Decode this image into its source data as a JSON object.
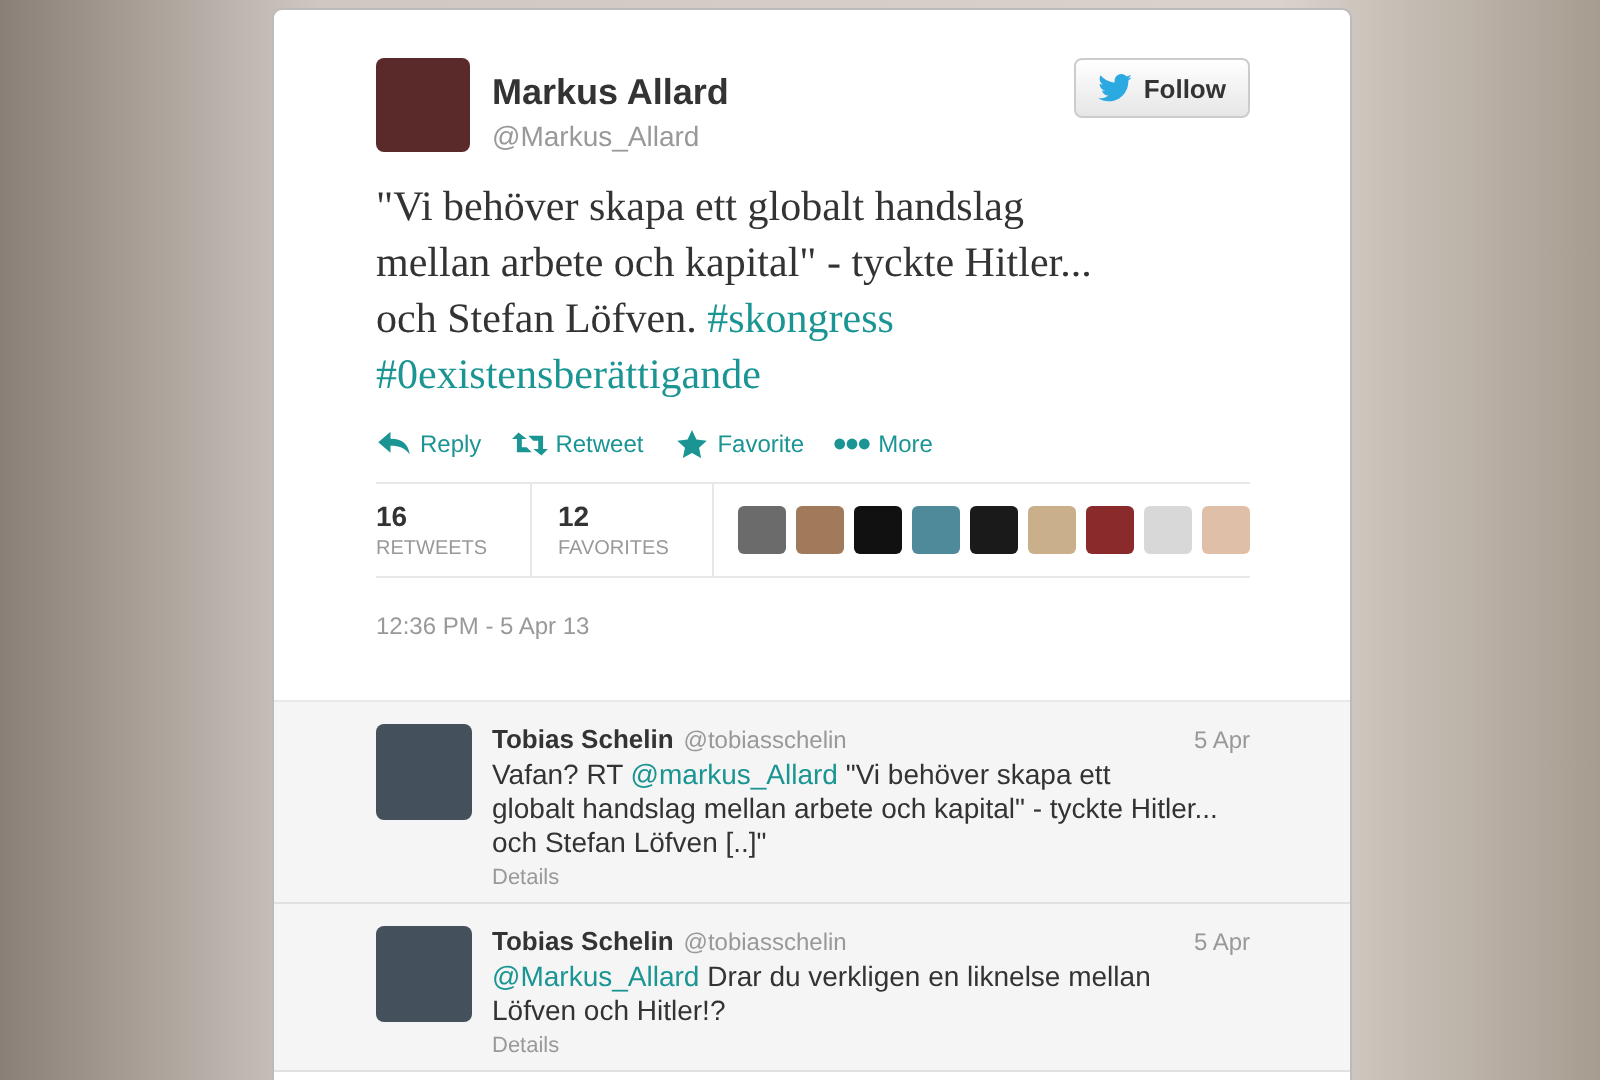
{
  "tweet": {
    "name": "Markus Allard",
    "handle": "@Markus_Allard",
    "follow_label": "Follow",
    "lines": [
      [
        {
          "kind": "text",
          "text": "\"Vi behöver skapa ett globalt handslag"
        }
      ],
      [
        {
          "kind": "text",
          "text": "mellan arbete och kapital\" - tyckte Hitler..."
        }
      ],
      [
        {
          "kind": "text",
          "text": "och Stefan Löfven. "
        },
        {
          "kind": "hashtag",
          "text": "#skongress"
        }
      ],
      [
        {
          "kind": "hashtag",
          "text": "#0existensberättigande"
        }
      ]
    ],
    "actions": [
      {
        "kind": "reply",
        "label": "Reply"
      },
      {
        "kind": "retweet",
        "label": "Retweet"
      },
      {
        "kind": "favorite",
        "label": "Favorite"
      },
      {
        "kind": "more",
        "label": "More"
      }
    ],
    "stats": [
      {
        "count": "16",
        "label": "RETWEETS"
      },
      {
        "count": "12",
        "label": "FAVORITES"
      }
    ],
    "timestamp": "12:36 PM - 5 Apr 13"
  },
  "replies": [
    {
      "name": "Tobias Schelin",
      "handle": "@tobiasschelin",
      "date": "5 Apr",
      "lines": [
        [
          {
            "kind": "text",
            "text": "Vafan? RT "
          },
          {
            "kind": "mention",
            "text": "@markus_Allard"
          },
          {
            "kind": "text",
            "text": " \"Vi behöver skapa ett"
          }
        ],
        [
          {
            "kind": "text",
            "text": "globalt handslag mellan arbete och kapital\" - tyckte Hitler..."
          }
        ],
        [
          {
            "kind": "text",
            "text": "och Stefan Löfven [..]\""
          }
        ]
      ],
      "details": "Details"
    },
    {
      "name": "Tobias Schelin",
      "handle": "@tobiasschelin",
      "date": "5 Apr",
      "lines": [
        [
          {
            "kind": "mention",
            "text": "@Markus_Allard"
          },
          {
            "kind": "text",
            "text": " Drar du verkligen en liknelse mellan"
          }
        ],
        [
          {
            "kind": "text",
            "text": "Löfven och Hitler!?"
          }
        ]
      ],
      "details": "Details"
    }
  ]
}
